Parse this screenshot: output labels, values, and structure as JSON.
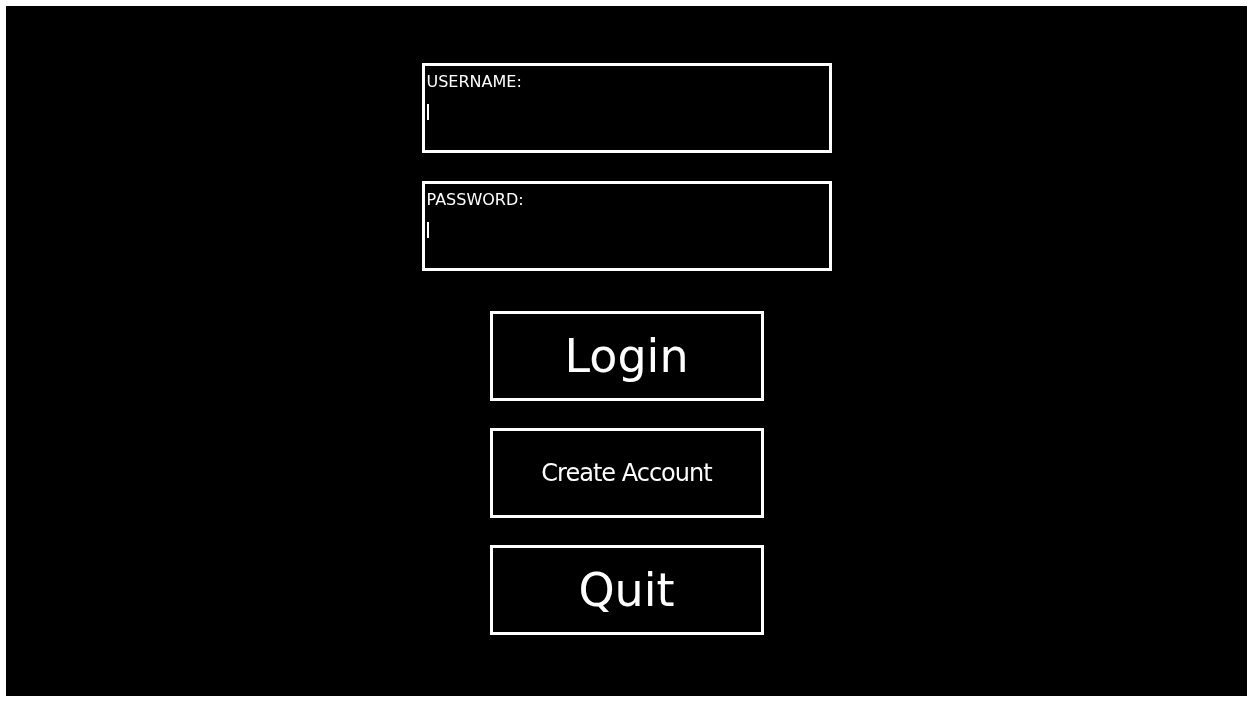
{
  "fields": [
    {
      "label": "USERNAME:"
    },
    {
      "label": "PASSWORD:"
    }
  ],
  "buttons": [
    {
      "label": "Login",
      "kind": "large"
    },
    {
      "label": "Create Account",
      "kind": "small"
    },
    {
      "label": "Quit",
      "kind": "large"
    }
  ]
}
